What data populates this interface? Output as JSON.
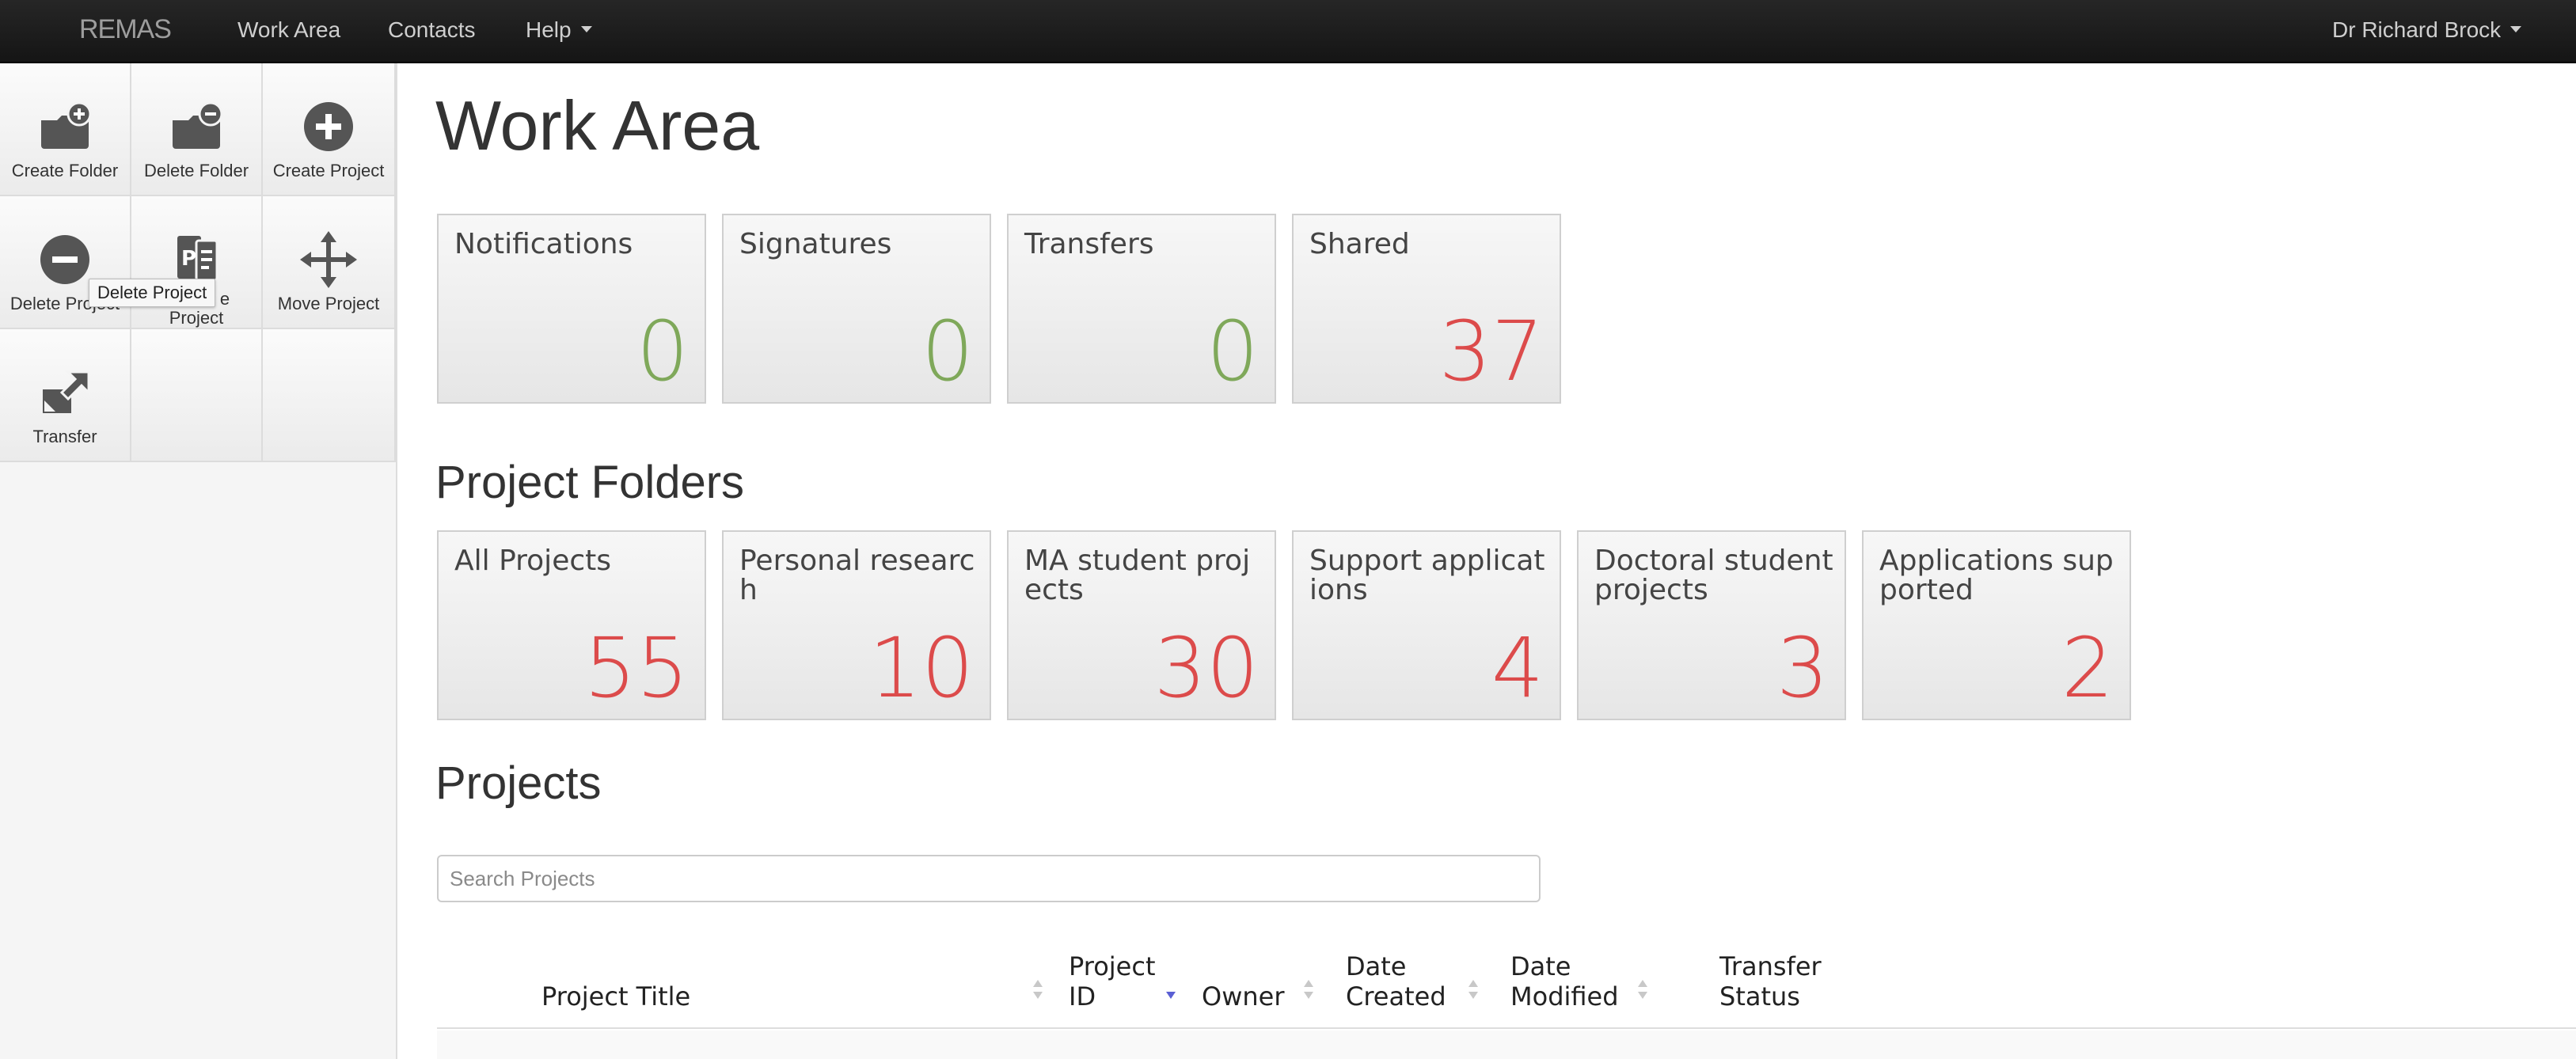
{
  "navbar": {
    "brand": "REMAS",
    "links": [
      "Work Area",
      "Contacts",
      "Help"
    ],
    "user": "Dr Richard Brock"
  },
  "toolbar": {
    "create_folder": "Create Folder",
    "delete_folder": "Delete Folder",
    "create_project": "Create Project",
    "delete_project": "Delete Project",
    "duplicate_project_fragment": "e",
    "duplicate_project_line2": "Project",
    "move_project": "Move Project",
    "transfer": "Transfer",
    "tooltip": "Delete Project"
  },
  "page_title": "Work Area",
  "summary_tiles": [
    {
      "label": "Notifications",
      "count": "0",
      "color": "#7fa85a"
    },
    {
      "label": "Signatures",
      "count": "0",
      "color": "#7fa85a"
    },
    {
      "label": "Transfers",
      "count": "0",
      "color": "#7fa85a"
    },
    {
      "label": "Shared",
      "count": "37",
      "color": "#dc4b4b"
    }
  ],
  "folders_heading": "Project Folders",
  "folder_tiles": [
    {
      "label": "All Projects",
      "count": "55"
    },
    {
      "label": "Personal research",
      "count": "10"
    },
    {
      "label": "MA student projects",
      "count": "30"
    },
    {
      "label": "Support applications",
      "count": "4"
    },
    {
      "label": "Doctoral student projects",
      "count": "3"
    },
    {
      "label": "Applications supported",
      "count": "2"
    }
  ],
  "projects_heading": "Projects",
  "search": {
    "placeholder": "Search Projects",
    "value": ""
  },
  "table": {
    "columns": [
      "Project Title",
      "Project ID",
      "Owner",
      "Date Created",
      "Date Modified",
      "Transfer Status"
    ],
    "sort_column": "Project ID",
    "sort_direction": "descending"
  }
}
